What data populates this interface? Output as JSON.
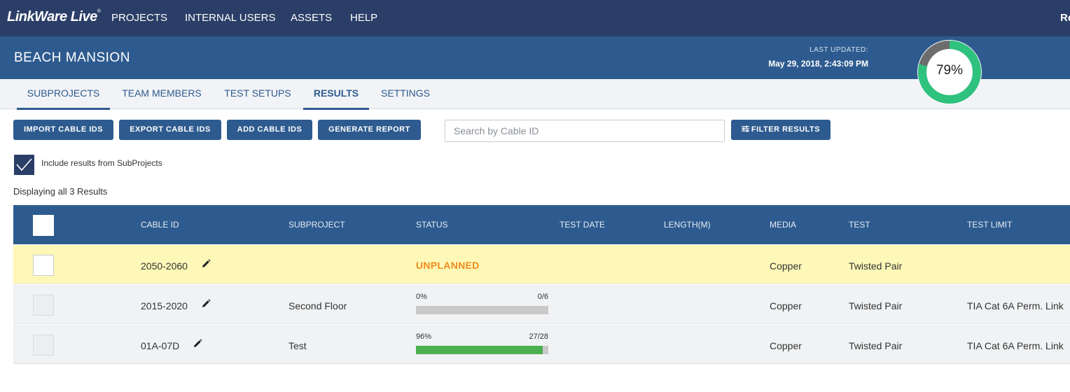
{
  "app": {
    "logo": "LinkWare Live",
    "logo_mark": "®"
  },
  "nav": {
    "items": [
      {
        "label": "PROJECTS"
      },
      {
        "label": "INTERNAL USERS"
      },
      {
        "label": "ASSETS"
      },
      {
        "label": "HELP"
      }
    ],
    "user": "Re"
  },
  "project": {
    "title": "BEACH MANSION",
    "last_updated_label": "LAST UPDATED:",
    "last_updated_value": "May 29, 2018, 2:43:09 PM",
    "completion_percent": 79,
    "completion_label": "79%"
  },
  "tabs": [
    {
      "label": "SUBPROJECTS",
      "active": false
    },
    {
      "label": "TEAM MEMBERS",
      "active": false
    },
    {
      "label": "TEST SETUPS",
      "active": false
    },
    {
      "label": "RESULTS",
      "active": true
    },
    {
      "label": "SETTINGS",
      "active": false
    }
  ],
  "toolbar": {
    "import_label": "IMPORT CABLE IDS",
    "export_label": "EXPORT CABLE IDS",
    "add_label": "ADD CABLE IDS",
    "report_label": "GENERATE REPORT",
    "search_placeholder": "Search by Cable ID",
    "filter_label": "FILTER RESULTS"
  },
  "include_subprojects": {
    "label": "Include results from SubProjects",
    "checked": true
  },
  "results_count": "Displaying all 3 Results",
  "table": {
    "columns": [
      "CABLE ID",
      "SUBPROJECT",
      "STATUS",
      "TEST DATE",
      "LENGTH(M)",
      "MEDIA",
      "TEST",
      "TEST LIMIT"
    ],
    "rows": [
      {
        "cable_id": "2050-2060",
        "subproject": "",
        "status": "UNPLANNED",
        "progress_label": "",
        "progress_count": "",
        "progress": null,
        "test_date": "",
        "length": "",
        "media": "Copper",
        "test": "Twisted Pair",
        "test_limit": ""
      },
      {
        "cable_id": "2015-2020",
        "subproject": "Second Floor",
        "status": "",
        "progress_label": "0%",
        "progress_count": "0/6",
        "progress": 0,
        "test_date": "",
        "length": "",
        "media": "Copper",
        "test": "Twisted Pair",
        "test_limit": "TIA Cat 6A Perm. Link"
      },
      {
        "cable_id": "01A-07D",
        "subproject": "Test",
        "status": "",
        "progress_label": "96%",
        "progress_count": "27/28",
        "progress": 0.96,
        "test_date": "",
        "length": "",
        "media": "Copper",
        "test": "Twisted Pair",
        "test_limit": "TIA Cat 6A Perm. Link"
      }
    ]
  },
  "colors": {
    "nav": "#2b3e67",
    "header": "#2e5b8f",
    "progress_fill": "#4caf50",
    "donut_done": "#2ec27e",
    "donut_remaining": "#6d6d6d",
    "unplanned": "#ef8c1c",
    "highlight_row": "#fef8b8"
  }
}
